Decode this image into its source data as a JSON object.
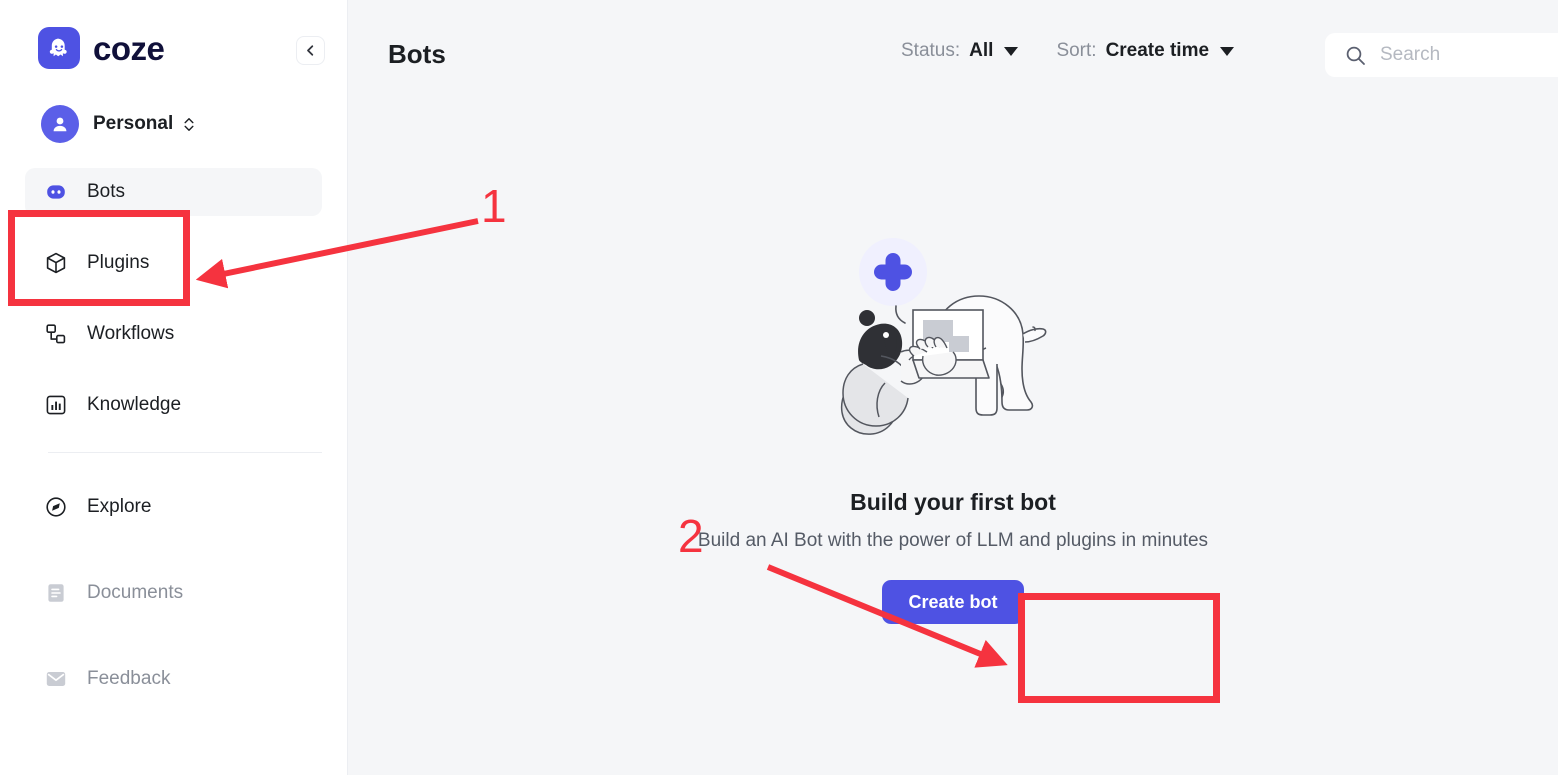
{
  "sidebar": {
    "brand": {
      "name": "coze",
      "logo_icon": "coze-ghost-logo"
    },
    "collapse_icon": "chevron-left-icon",
    "workspace": {
      "name": "Personal",
      "avatar_icon": "user-avatar-icon",
      "selector_icon": "chevron-updown-icon"
    },
    "nav_primary": [
      {
        "label": "Bots",
        "icon": "bot-face-icon",
        "active": true
      },
      {
        "label": "Plugins",
        "icon": "cube-icon",
        "active": false
      },
      {
        "label": "Workflows",
        "icon": "workflow-nodes-icon",
        "active": false
      },
      {
        "label": "Knowledge",
        "icon": "bar-chart-box-icon",
        "active": false
      }
    ],
    "nav_secondary": [
      {
        "label": "Explore",
        "icon": "compass-icon",
        "muted": false
      },
      {
        "label": "Documents",
        "icon": "document-icon",
        "muted": true
      },
      {
        "label": "Feedback",
        "icon": "envelope-icon",
        "muted": true
      }
    ]
  },
  "header": {
    "title": "Bots",
    "status_filter": {
      "label": "Status:",
      "value": "All",
      "caret_icon": "caret-down-icon"
    },
    "sort_filter": {
      "label": "Sort:",
      "value": "Create time",
      "caret_icon": "caret-down-icon"
    },
    "search": {
      "placeholder": "Search",
      "value": "",
      "icon": "search-icon"
    }
  },
  "empty_state": {
    "illustration": "person-with-laptop-and-creature-illustration",
    "plus_icon": "plus-icon",
    "title": "Build your first bot",
    "subtitle": "Build an AI Bot with the power of LLM and plugins in minutes",
    "cta_label": "Create bot"
  },
  "annotations": {
    "step1": {
      "number": "1",
      "target": "Bots"
    },
    "step2": {
      "number": "2",
      "target": "Create bot"
    },
    "color": "#f5333f"
  },
  "colors": {
    "brand_purple": "#4e52e3",
    "sidebar_bg": "#ffffff",
    "main_bg": "#f5f6f8",
    "text_primary": "#1c1f23",
    "text_muted": "#8a8f99",
    "annotation_red": "#f5333f"
  }
}
